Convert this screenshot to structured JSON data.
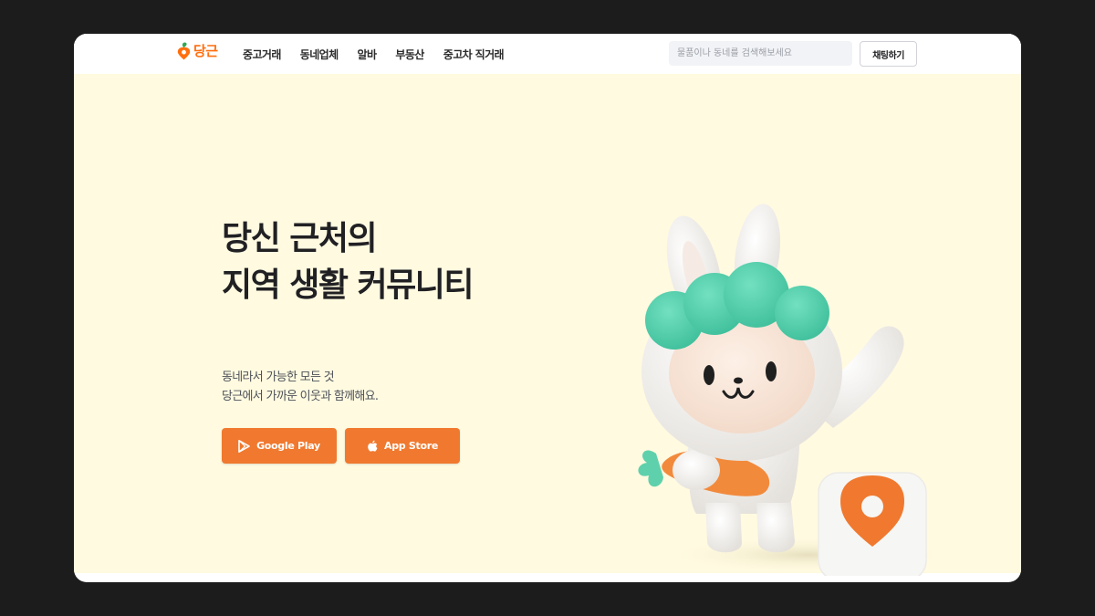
{
  "brand": {
    "name": "당근",
    "color": "#ff6f0f",
    "icon": "carrot-pin-icon"
  },
  "nav": {
    "items": [
      {
        "label": "중고거래"
      },
      {
        "label": "동네업체"
      },
      {
        "label": "알바"
      },
      {
        "label": "부동산"
      },
      {
        "label": "중고차 직거래"
      }
    ],
    "search_placeholder": "물품이나 동네를 검색해보세요",
    "chat_label": "채팅하기"
  },
  "hero": {
    "headline_line1": "당신 근처의",
    "headline_line2": "지역 생활 커뮤니티",
    "sub_line1": "동네라서 가능한 모든 것",
    "sub_line2": "당근에서 가까운 이웃과 함께해요.",
    "background": "#fffae0",
    "buttons": {
      "google_play": {
        "label": "Google Play",
        "icon": "google-play-icon"
      },
      "app_store": {
        "label": "App Store",
        "icon": "apple-icon"
      }
    },
    "button_color": "#f0792f",
    "illustration": "bunny-mascot-with-carrot-and-app-icon"
  }
}
